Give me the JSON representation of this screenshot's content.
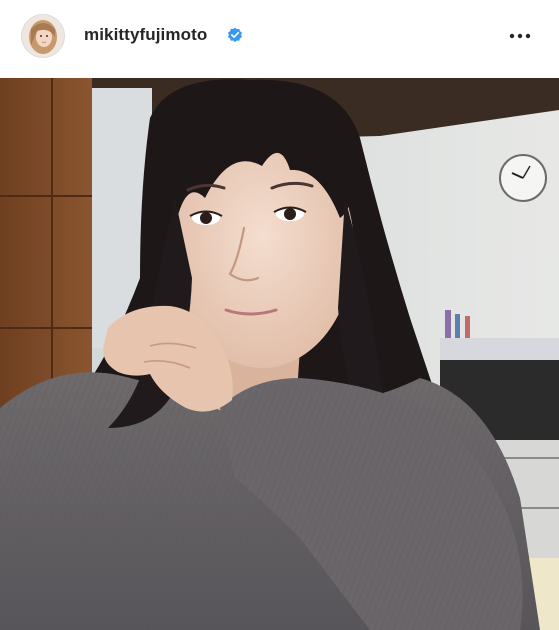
{
  "post": {
    "author": {
      "username": "mikittyfujimoto",
      "verified": true,
      "avatar": "avatar-photo"
    },
    "header": {
      "more_icon": "more-options-icon"
    },
    "image": {
      "kind": "selfie-photo"
    }
  },
  "colors": {
    "verified_badge": "#3897f0",
    "username_text": "#262626"
  }
}
